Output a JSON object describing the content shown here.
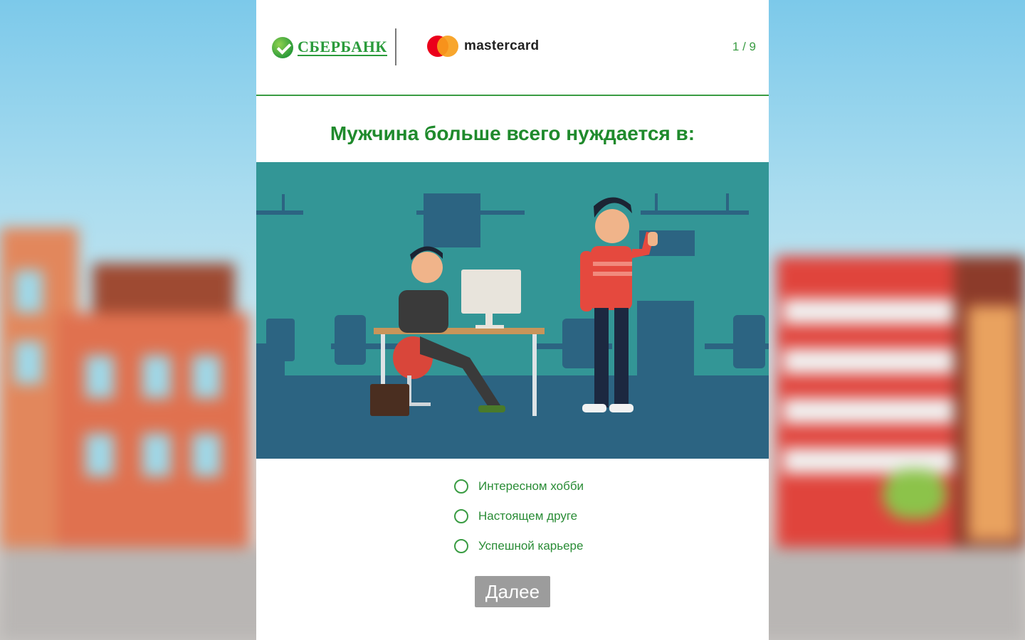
{
  "header": {
    "sber_logo_text": "СБЕРБАНК",
    "mastercard_text": "mastercard",
    "progress_label": "1 / 9"
  },
  "question": {
    "text": "Мужчина больше всего нуждается в:"
  },
  "options": [
    {
      "label": "Интересном хобби",
      "selected": false
    },
    {
      "label": "Настоящем друге",
      "selected": false
    },
    {
      "label": "Успешной карьере",
      "selected": false
    }
  ],
  "next_button": {
    "label": "Далее"
  },
  "colors": {
    "accent_green": "#3a9c43",
    "title_green": "#1f8a2c",
    "button_disabled": "#9c9c9c",
    "illustration_bg": "#339696"
  }
}
